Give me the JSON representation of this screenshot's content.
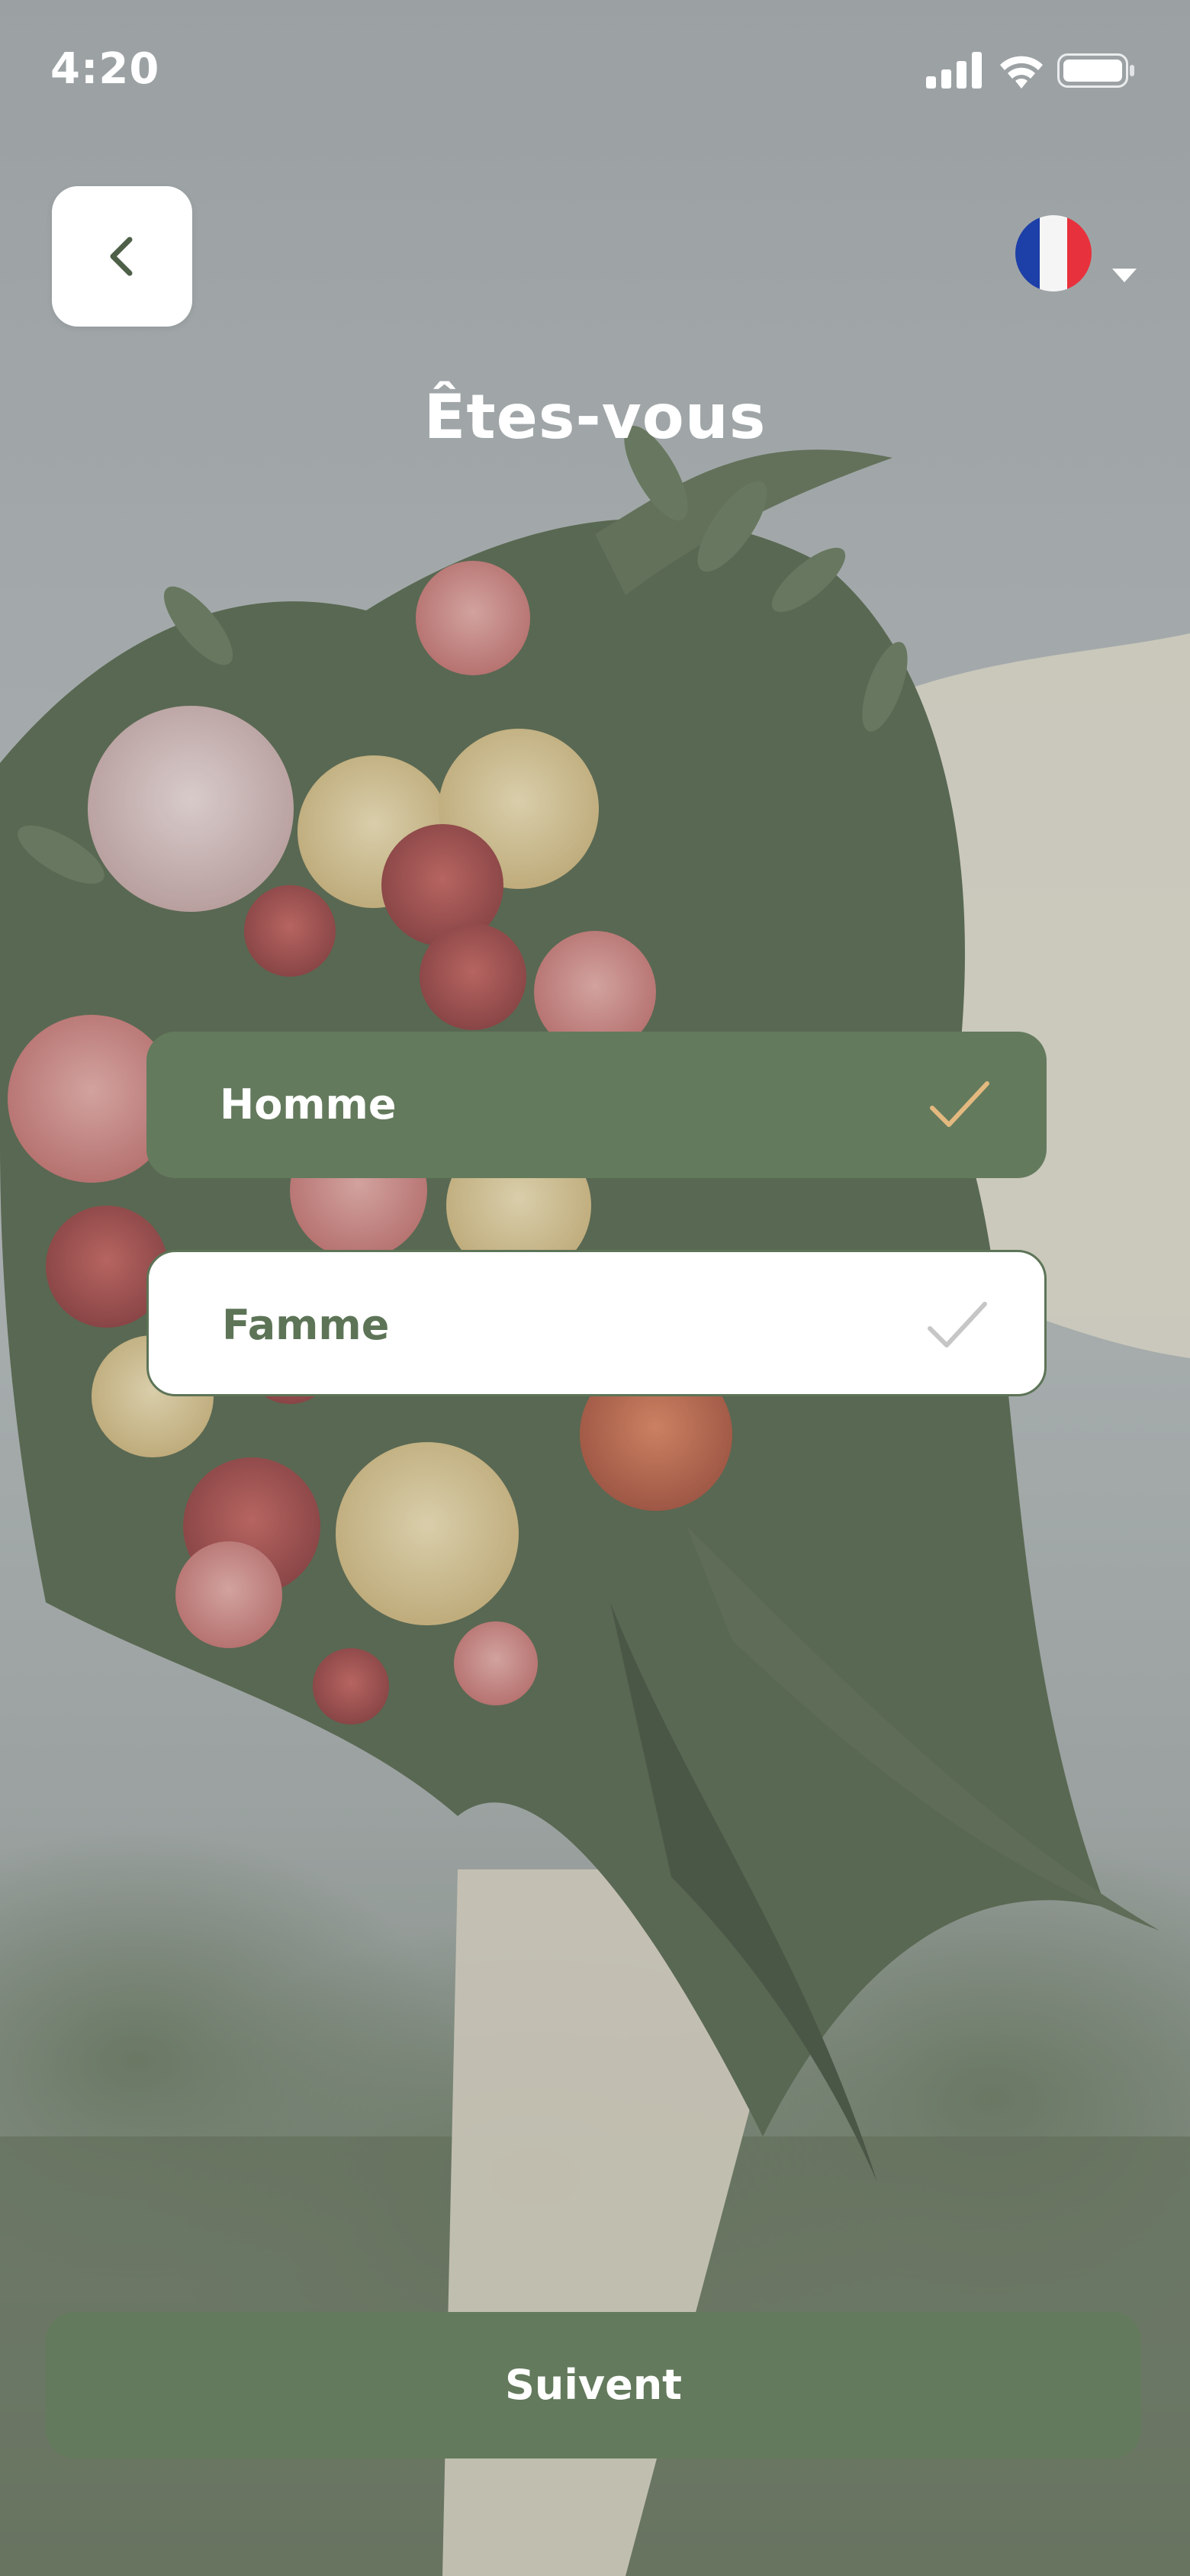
{
  "status_bar": {
    "time": "4:20"
  },
  "header": {
    "back_icon": "chevron-left-icon",
    "language_flag": "french-flag-icon",
    "title": "Êtes-vous"
  },
  "options": [
    {
      "label": "Homme",
      "selected": true
    },
    {
      "label": "Famme",
      "selected": false
    }
  ],
  "footer": {
    "next_label": "Suivent"
  },
  "colors": {
    "accent": "#647a5d",
    "check_selected": "#e3b97f",
    "check_unselected": "#c6c6c6",
    "button_text": "#ffffff"
  }
}
